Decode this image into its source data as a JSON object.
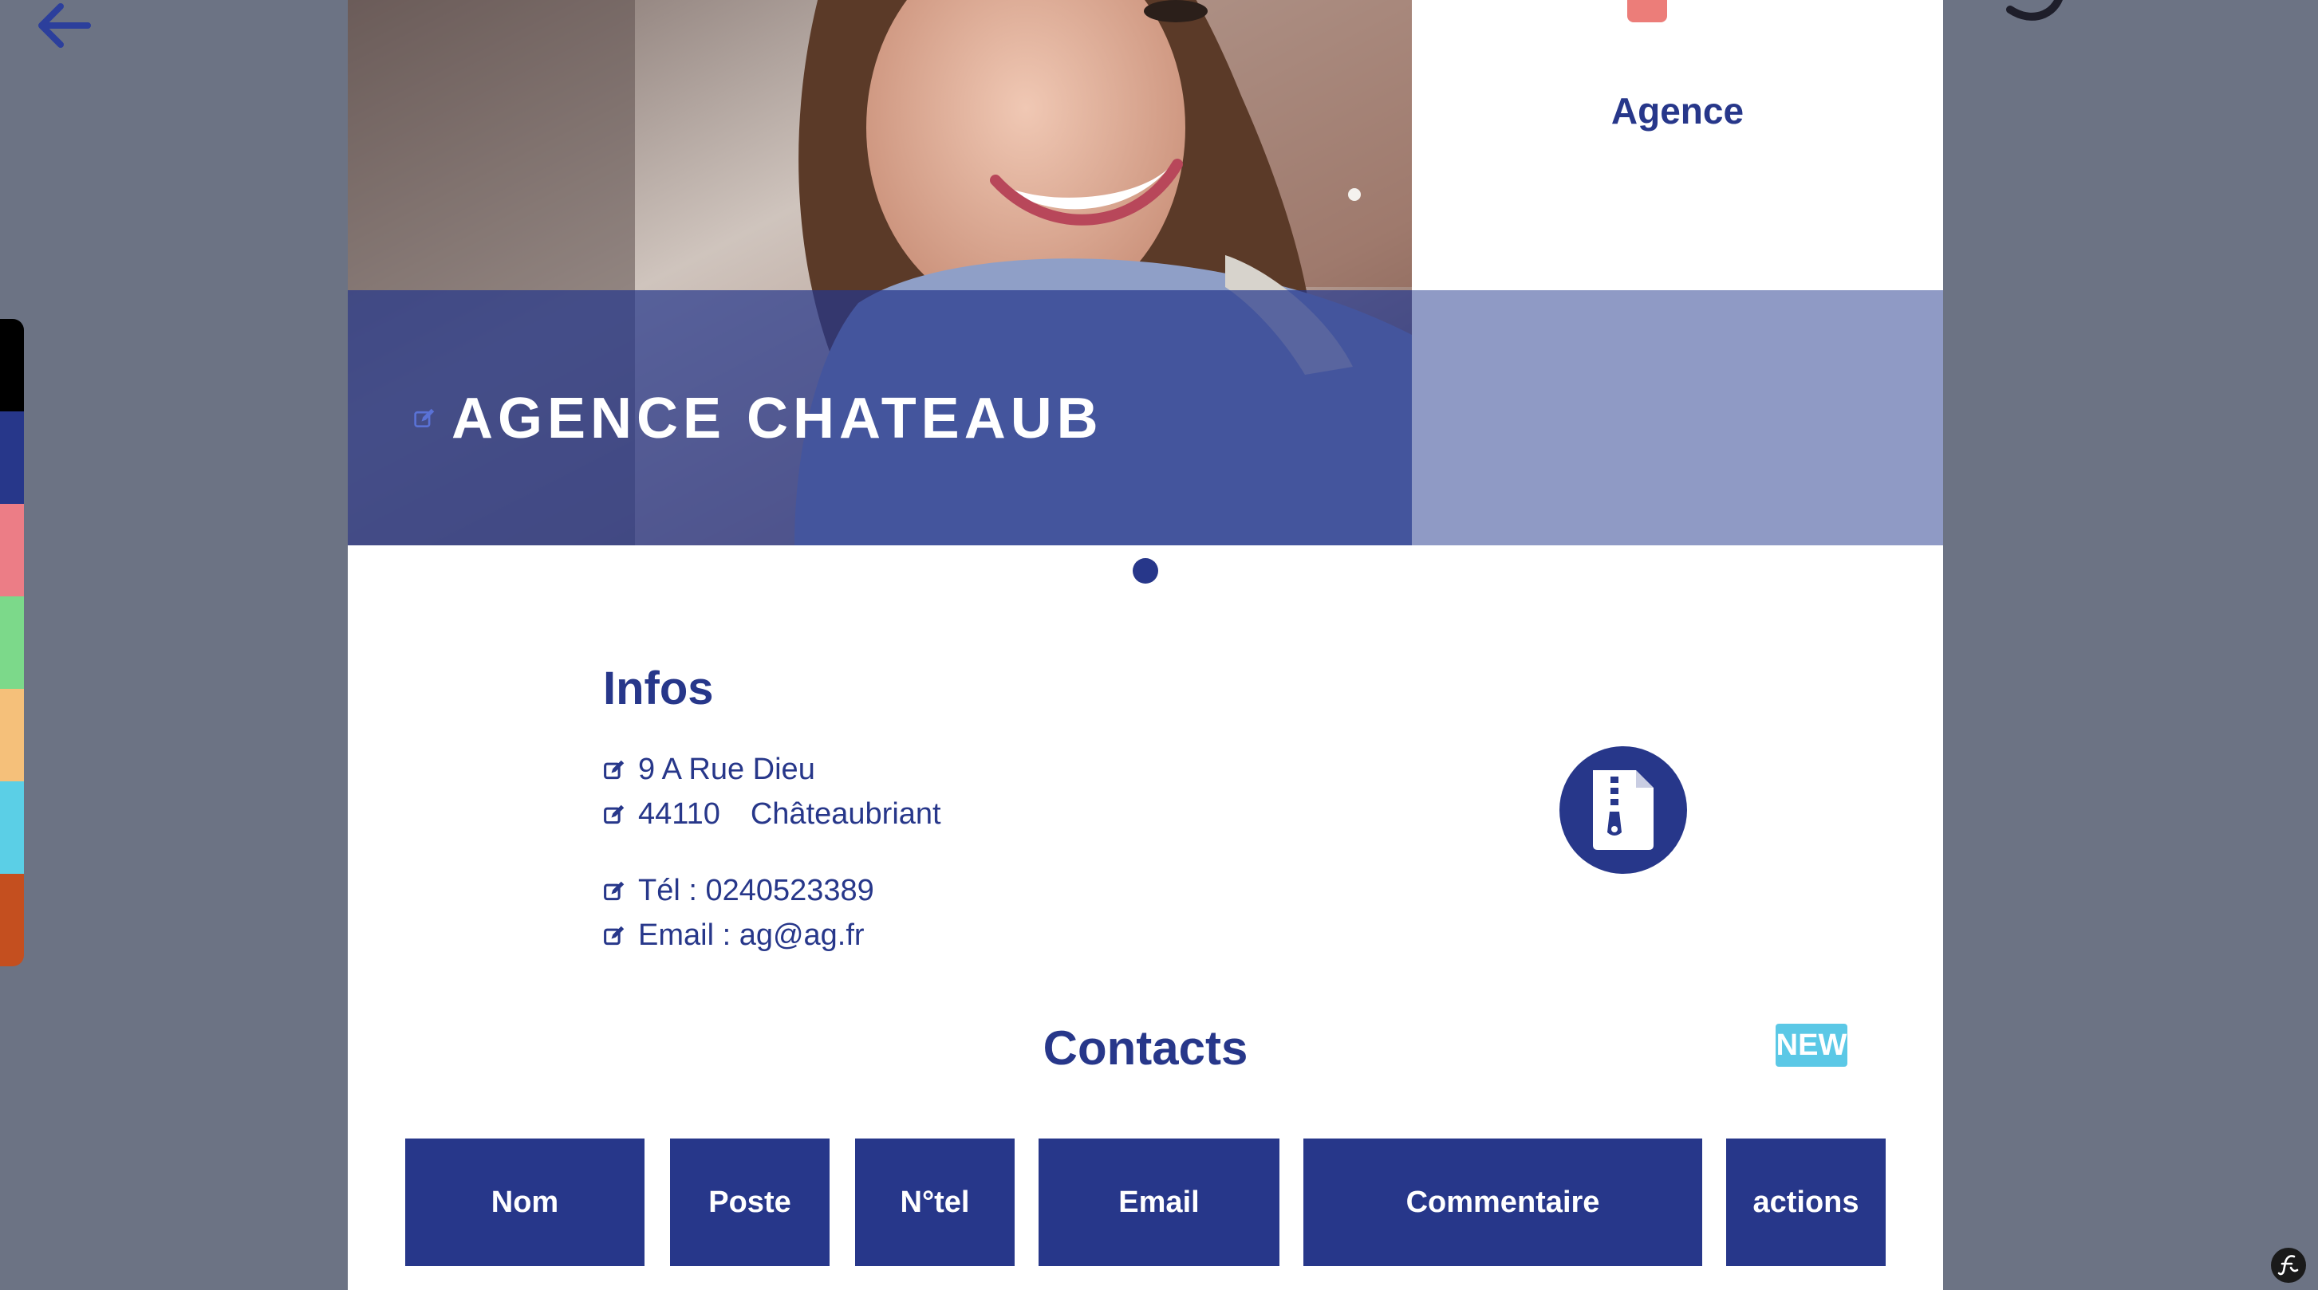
{
  "hero": {
    "title": "AGENCE CHATEAUB"
  },
  "side_panel": {
    "label": "Agence"
  },
  "infos": {
    "title": "Infos",
    "address": "9 A Rue Dieu",
    "postal_code": "44110",
    "city": "Châteaubriant",
    "phone": "Tél : 0240523389",
    "email": "Email : ag@ag.fr"
  },
  "contacts": {
    "title": "Contacts",
    "new_label": "NEW",
    "columns": [
      "Nom",
      "Poste",
      "N°tel",
      "Email",
      "Commentaire",
      "actions"
    ]
  },
  "theme_colors": [
    "#000000",
    "#27378a",
    "#ec7d86",
    "#7cd98a",
    "#f5c07a",
    "#5bcfe6",
    "#c44f1f"
  ],
  "icons": {
    "back": "arrow-left-icon",
    "edit": "edit-icon",
    "zip": "file-zip-icon",
    "framework": "symfony-logo-icon"
  }
}
